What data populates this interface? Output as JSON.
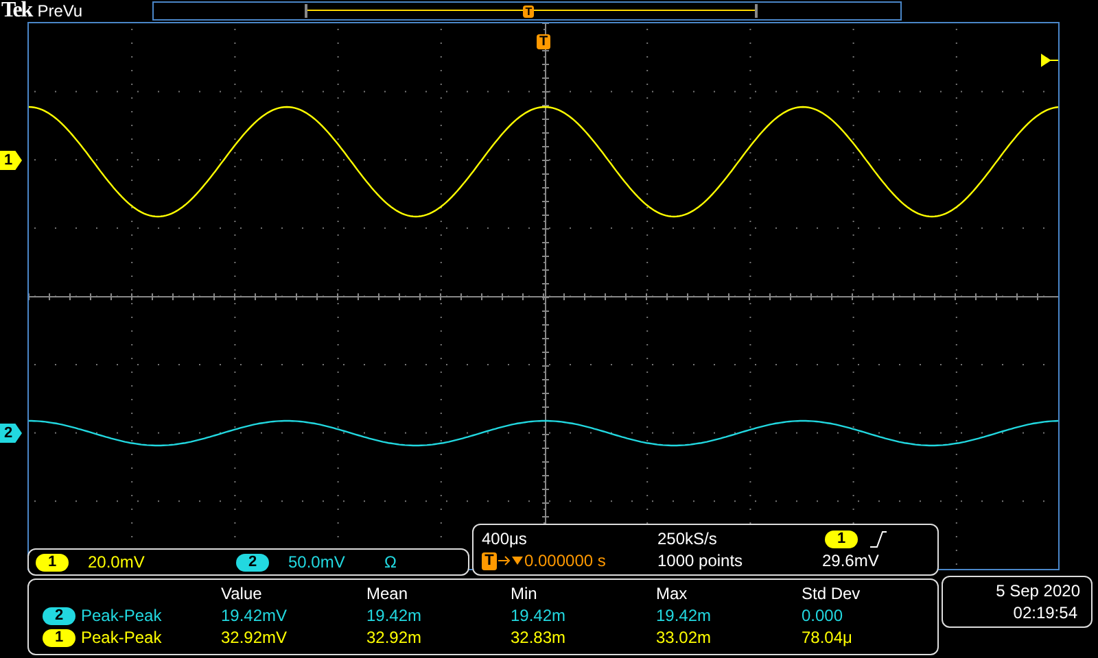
{
  "top_bar": {
    "brand": "Tek",
    "mode": "PreVu",
    "trigger_marker": "T"
  },
  "graticule": {
    "trigger_marker": "T",
    "channel_markers": [
      {
        "label": "1",
        "color": "#ffff00"
      },
      {
        "label": "2",
        "color": "#22d8e0"
      }
    ]
  },
  "channel_settings": [
    {
      "channel": "1",
      "scale": "20.0mV",
      "color": "#ffff00"
    },
    {
      "channel": "2",
      "scale": "50.0mV",
      "termination": "Ω",
      "color": "#22d8e0"
    }
  ],
  "horizontal": {
    "time_scale": "400μs",
    "trigger_icon": "T",
    "trigger_position": "0.000000 s",
    "sample_rate": "250kS/s",
    "record_length": "1000 points",
    "trigger_channel": "1",
    "trigger_level": "29.6mV"
  },
  "measurements": {
    "columns": [
      "Value",
      "Mean",
      "Min",
      "Max",
      "Std Dev"
    ],
    "rows": [
      {
        "channel": "2",
        "name": "Peak-Peak",
        "color": "#22d8e0",
        "values": [
          "19.42mV",
          "19.42m",
          "19.42m",
          "19.42m",
          "0.000"
        ]
      },
      {
        "channel": "1",
        "name": "Peak-Peak",
        "color": "#ffff00",
        "values": [
          "32.92mV",
          "32.92m",
          "32.83m",
          "33.02m",
          "78.04μ"
        ]
      }
    ]
  },
  "datetime": {
    "date": "5 Sep 2020",
    "time": "02:19:54"
  }
}
